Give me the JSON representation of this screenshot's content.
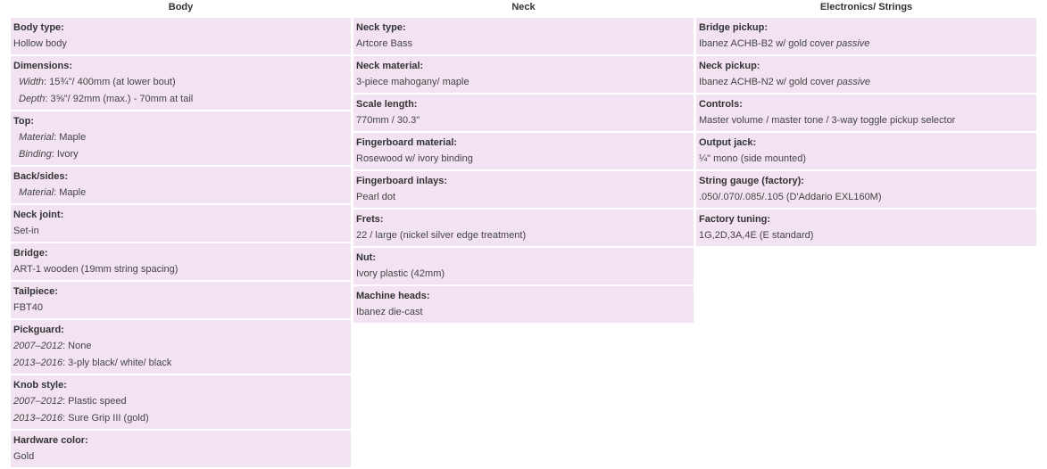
{
  "columns": [
    {
      "header": "Body",
      "rows": [
        {
          "label": "Body type:",
          "lines": [
            {
              "indent": false,
              "sub": "",
              "text": "Hollow body",
              "em": ""
            }
          ]
        },
        {
          "label": "Dimensions:",
          "lines": [
            {
              "indent": true,
              "sub": "Width",
              "text": ": 15¾\"/ 400mm (at lower bout)",
              "em": ""
            },
            {
              "indent": true,
              "sub": "Depth",
              "text": ": 3⅝\"/ 92mm (max.) - 70mm at tail",
              "em": ""
            }
          ]
        },
        {
          "label": "Top:",
          "lines": [
            {
              "indent": true,
              "sub": "Material",
              "text": ": Maple",
              "em": ""
            },
            {
              "indent": true,
              "sub": "Binding",
              "text": ": Ivory",
              "em": ""
            }
          ]
        },
        {
          "label": "Back/sides:",
          "lines": [
            {
              "indent": true,
              "sub": "Material",
              "text": ": Maple",
              "em": ""
            }
          ]
        },
        {
          "label": "Neck joint:",
          "lines": [
            {
              "indent": false,
              "sub": "",
              "text": "Set-in",
              "em": ""
            }
          ]
        },
        {
          "label": "Bridge:",
          "lines": [
            {
              "indent": false,
              "sub": "",
              "text": "ART-1 wooden (19mm string spacing)",
              "em": ""
            }
          ]
        },
        {
          "label": "Tailpiece:",
          "lines": [
            {
              "indent": false,
              "sub": "",
              "text": "FBT40",
              "em": ""
            }
          ]
        },
        {
          "label": "Pickguard:",
          "lines": [
            {
              "indent": false,
              "sub": "2007–2012",
              "text": ": None",
              "em": ""
            },
            {
              "indent": false,
              "sub": "2013–2016",
              "text": ": 3-ply black/ white/ black",
              "em": ""
            }
          ]
        },
        {
          "label": "Knob style:",
          "lines": [
            {
              "indent": false,
              "sub": "2007–2012",
              "text": ": Plastic speed",
              "em": ""
            },
            {
              "indent": false,
              "sub": "2013–2016",
              "text": ": Sure Grip III (gold)",
              "em": ""
            }
          ]
        },
        {
          "label": "Hardware color:",
          "lines": [
            {
              "indent": false,
              "sub": "",
              "text": "Gold",
              "em": ""
            }
          ]
        }
      ]
    },
    {
      "header": "Neck",
      "rows": [
        {
          "label": "Neck type:",
          "lines": [
            {
              "indent": false,
              "sub": "",
              "text": "Artcore Bass",
              "em": ""
            }
          ]
        },
        {
          "label": "Neck material:",
          "lines": [
            {
              "indent": false,
              "sub": "",
              "text": "3-piece mahogany/ maple",
              "em": ""
            }
          ]
        },
        {
          "label": "Scale length:",
          "lines": [
            {
              "indent": false,
              "sub": "",
              "text": "770mm / 30.3\"",
              "em": ""
            }
          ]
        },
        {
          "label": "Fingerboard material:",
          "lines": [
            {
              "indent": false,
              "sub": "",
              "text": "Rosewood w/ ivory binding",
              "em": ""
            }
          ]
        },
        {
          "label": "Fingerboard inlays:",
          "lines": [
            {
              "indent": false,
              "sub": "",
              "text": "Pearl dot",
              "em": ""
            }
          ]
        },
        {
          "label": "Frets:",
          "lines": [
            {
              "indent": false,
              "sub": "",
              "text": "22 / large (nickel silver edge treatment)",
              "em": ""
            }
          ]
        },
        {
          "label": "Nut:",
          "lines": [
            {
              "indent": false,
              "sub": "",
              "text": "Ivory plastic (42mm)",
              "em": ""
            }
          ]
        },
        {
          "label": "Machine heads:",
          "lines": [
            {
              "indent": false,
              "sub": "",
              "text": "Ibanez die-cast",
              "em": ""
            }
          ]
        }
      ]
    },
    {
      "header": "Electronics/ Strings",
      "rows": [
        {
          "label": "Bridge pickup:",
          "lines": [
            {
              "indent": false,
              "sub": "",
              "text": "Ibanez ACHB-B2 w/ gold cover ",
              "em": "passive"
            }
          ]
        },
        {
          "label": "Neck pickup:",
          "lines": [
            {
              "indent": false,
              "sub": "",
              "text": "Ibanez ACHB-N2 w/ gold cover ",
              "em": "passive"
            }
          ]
        },
        {
          "label": "Controls:",
          "lines": [
            {
              "indent": false,
              "sub": "",
              "text": "Master volume / master tone / 3-way toggle pickup selector",
              "em": ""
            }
          ]
        },
        {
          "label": "Output jack:",
          "lines": [
            {
              "indent": false,
              "sub": "",
              "text": "¼\" mono (side mounted)",
              "em": ""
            }
          ]
        },
        {
          "label": "String gauge (factory):",
          "lines": [
            {
              "indent": false,
              "sub": "",
              "text": ".050/.070/.085/.105 (D'Addario EXL160M)",
              "em": ""
            }
          ]
        },
        {
          "label": "Factory tuning:",
          "lines": [
            {
              "indent": false,
              "sub": "",
              "text": "1G,2D,3A,4E (E standard)",
              "em": ""
            }
          ]
        }
      ]
    }
  ]
}
